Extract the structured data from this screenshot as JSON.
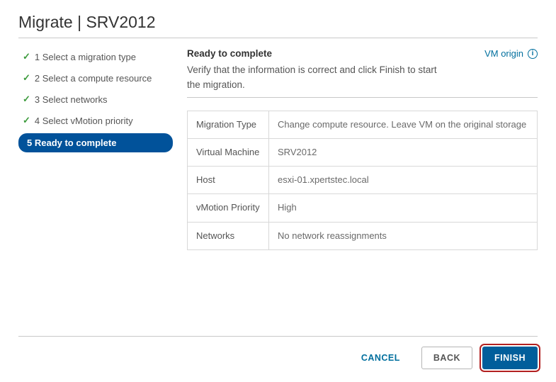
{
  "title": "Migrate | SRV2012",
  "sidebar": {
    "items": [
      {
        "label": "1 Select a migration type"
      },
      {
        "label": "2 Select a compute resource"
      },
      {
        "label": "3 Select networks"
      },
      {
        "label": "4 Select vMotion priority"
      },
      {
        "label": "5 Ready to complete"
      }
    ]
  },
  "main": {
    "heading": "Ready to complete",
    "subheading": "Verify that the information is correct and click Finish to start the migration.",
    "origin_label": "VM origin"
  },
  "summary": {
    "migration_type": {
      "label": "Migration Type",
      "value": "Change compute resource. Leave VM on the original storage"
    },
    "vm": {
      "label": "Virtual Machine",
      "value": "SRV2012"
    },
    "host": {
      "label": "Host",
      "value": "esxi-01.xpertstec.local"
    },
    "priority": {
      "label": "vMotion Priority",
      "value": "High"
    },
    "networks": {
      "label": "Networks",
      "value": "No network reassignments"
    }
  },
  "footer": {
    "cancel": "CANCEL",
    "back": "BACK",
    "finish": "FINISH"
  }
}
